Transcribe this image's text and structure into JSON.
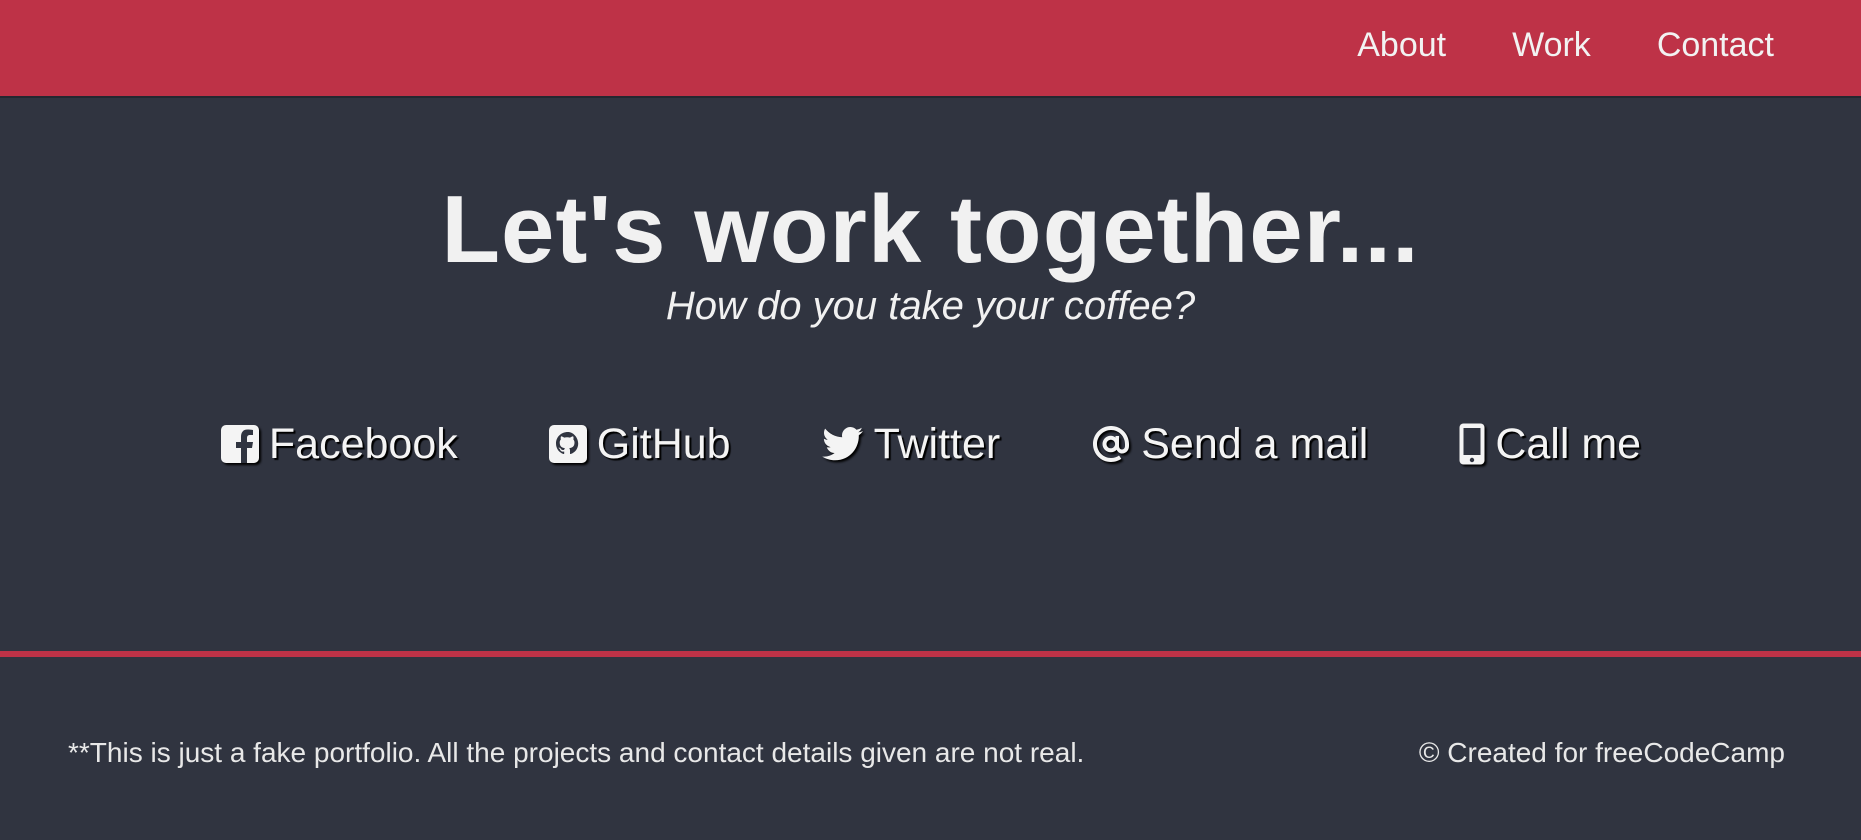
{
  "nav": {
    "links": [
      {
        "label": "About"
      },
      {
        "label": "Work"
      },
      {
        "label": "Contact"
      }
    ]
  },
  "hero": {
    "title": "Let's work together...",
    "subtitle": "How do you take your coffee?"
  },
  "contacts": [
    {
      "label": "Facebook",
      "icon": "facebook-icon"
    },
    {
      "label": "GitHub",
      "icon": "github-icon"
    },
    {
      "label": "Twitter",
      "icon": "twitter-icon"
    },
    {
      "label": "Send a mail",
      "icon": "at-sign-icon"
    },
    {
      "label": "Call me",
      "icon": "mobile-phone-icon"
    }
  ],
  "footer": {
    "note": "**This is just a fake portfolio. All the projects and contact details given are not real.",
    "credit": "© Created for freeCodeCamp"
  },
  "colors": {
    "accent": "#be3247",
    "background": "#303440",
    "text": "#f0f0f0"
  }
}
